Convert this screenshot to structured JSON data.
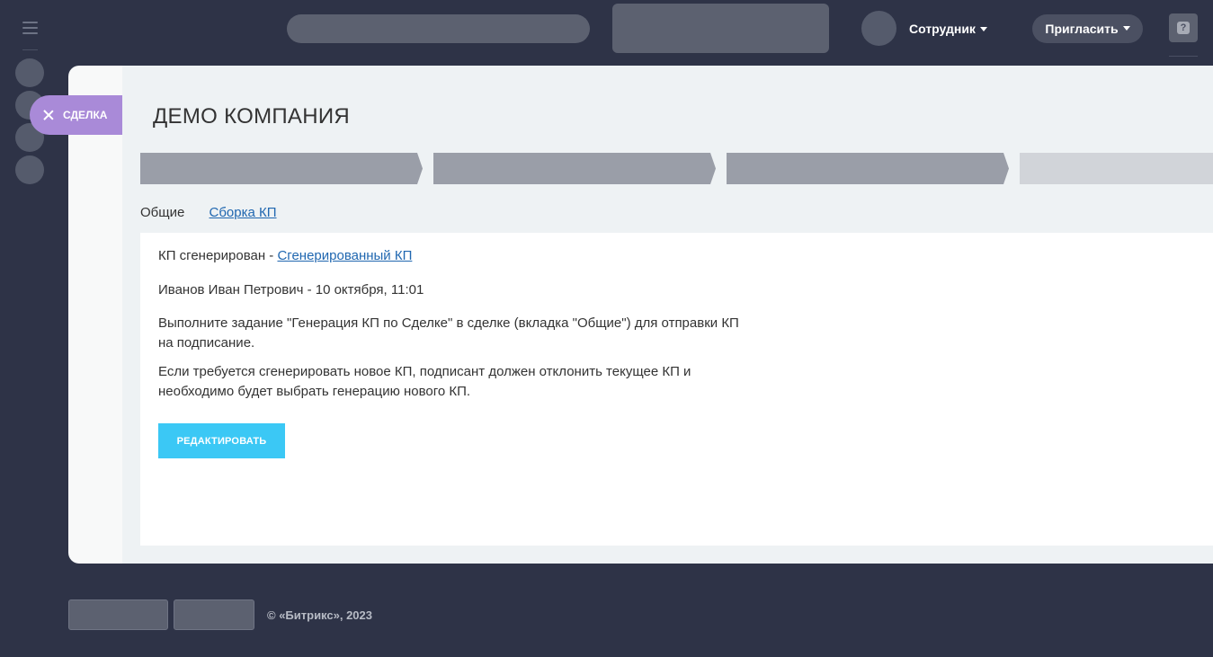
{
  "header": {
    "user_name": "Сотрудник",
    "invite_label": "Пригласить",
    "help_symbol": "?"
  },
  "deal_tab": {
    "label": "СДЕЛКА"
  },
  "page": {
    "title": "ДЕМО КОМПАНИЯ"
  },
  "stages": [
    {
      "color": "#9a9ea8"
    },
    {
      "color": "#9a9ea8"
    },
    {
      "color": "#9a9ea8"
    },
    {
      "color": "#d1d4d9"
    }
  ],
  "tabs": [
    {
      "label": "Общие"
    },
    {
      "label": "Сборка КП"
    }
  ],
  "content": {
    "status_prefix": "КП сгенерирован - ",
    "status_link": "Сгенерированный КП",
    "author_line": "Иванов Иван Петрович - 10 октября, 11:01",
    "instruction": "Выполните задание \"Генерация КП по Сделке\" в сделке (вкладка \"Общие\") для отправки КП на подписание.",
    "note": "Если требуется сгенерировать новое КП, подписант должен отклонить текущее КП и необходимо будет выбрать генерацию нового КП.",
    "edit_button": "РЕДАКТИРОВАТЬ"
  },
  "footer": {
    "copyright": "© «Битрикс», 2023"
  },
  "colors": {
    "background": "#2e3347",
    "accent_button": "#3bc8f5",
    "deal_tab": "#a98ad8",
    "link": "#2067b0"
  }
}
